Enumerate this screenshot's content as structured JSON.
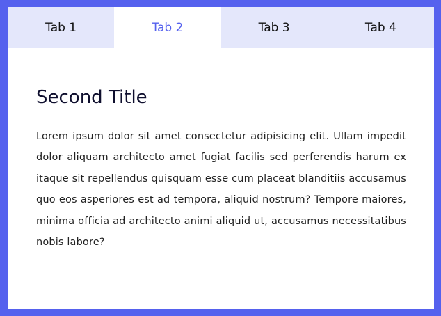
{
  "tabs": [
    {
      "label": "Tab 1"
    },
    {
      "label": "Tab 2"
    },
    {
      "label": "Tab 3"
    },
    {
      "label": "Tab 4"
    }
  ],
  "active_tab_index": 1,
  "content": {
    "title": "Second Title",
    "body": "Lorem ipsum dolor sit amet consectetur adipisicing elit. Ullam impedit dolor aliquam architecto amet fugiat facilis sed perferendis harum ex itaque sit repellendus quisquam esse cum placeat blanditiis accusamus quo eos asperiores est ad tempora, aliquid nostrum? Tempore maiores, minima officia ad architecto animi aliquid ut, accusamus necessitatibus nobis labore?"
  },
  "colors": {
    "background": "#5561ee",
    "tab_bar": "#e4e7fb",
    "active_tab_text": "#5561ee",
    "card": "#ffffff"
  }
}
